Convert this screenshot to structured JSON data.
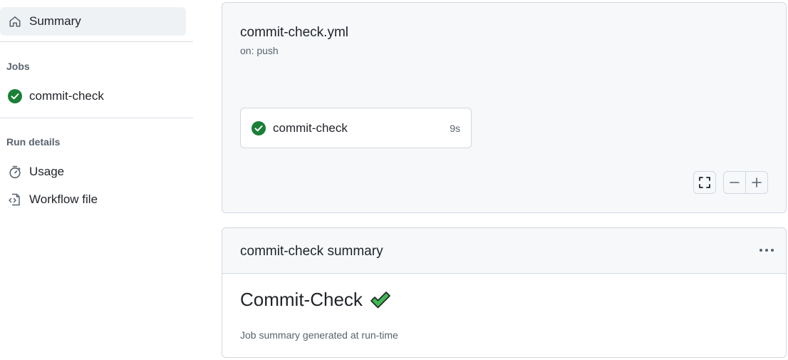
{
  "sidebar": {
    "summary_label": "Summary",
    "jobs_heading": "Jobs",
    "jobs": [
      {
        "label": "commit-check",
        "status": "success"
      }
    ],
    "run_details_heading": "Run details",
    "usage_label": "Usage",
    "workflow_file_label": "Workflow file"
  },
  "workflow": {
    "file_name": "commit-check.yml",
    "trigger": "on: push",
    "job": {
      "name": "commit-check",
      "duration": "9s",
      "status": "success"
    }
  },
  "summary": {
    "title": "commit-check summary",
    "heading": "Commit-Check",
    "heading_emoji": "heavy-check-mark",
    "note": "Job summary generated at run-time"
  },
  "colors": {
    "success": "#1a7f37",
    "emoji_check": "#3fb950",
    "muted_text": "#59636e",
    "border": "#d1d9e0",
    "panel_bg": "#f6f8fa"
  }
}
